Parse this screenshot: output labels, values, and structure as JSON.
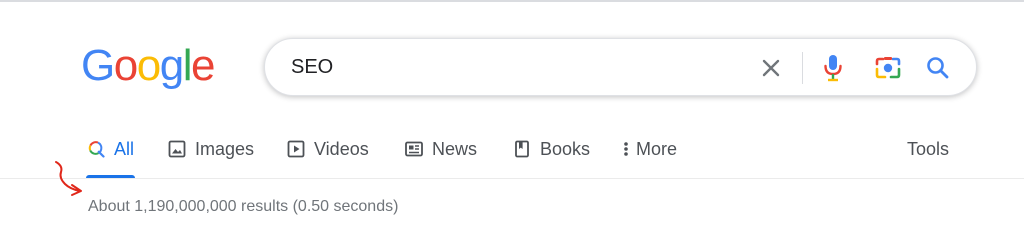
{
  "logo": {
    "letters": [
      "G",
      "o",
      "o",
      "g",
      "l",
      "e"
    ],
    "colors": [
      "#4285F4",
      "#EA4335",
      "#FBBC05",
      "#4285F4",
      "#34A853",
      "#EA4335"
    ]
  },
  "search": {
    "query": "SEO",
    "clear_icon": "close-icon",
    "voice_icon": "microphone-icon",
    "lens_icon": "camera-icon",
    "search_icon": "search-icon"
  },
  "tabs": [
    {
      "label": "All",
      "icon": "search-icon",
      "active": true
    },
    {
      "label": "Images",
      "icon": "image-icon",
      "active": false
    },
    {
      "label": "Videos",
      "icon": "play-icon",
      "active": false
    },
    {
      "label": "News",
      "icon": "news-icon",
      "active": false
    },
    {
      "label": "Books",
      "icon": "book-icon",
      "active": false
    },
    {
      "label": "More",
      "icon": "more-vert-icon",
      "active": false
    }
  ],
  "tools_label": "Tools",
  "result_stats": "About 1,190,000,000 results (0.50 seconds)",
  "colors": {
    "accent": "#1a73e8",
    "text_secondary": "#4d5156",
    "stats": "#70757a",
    "annotation": "#e0271a"
  }
}
